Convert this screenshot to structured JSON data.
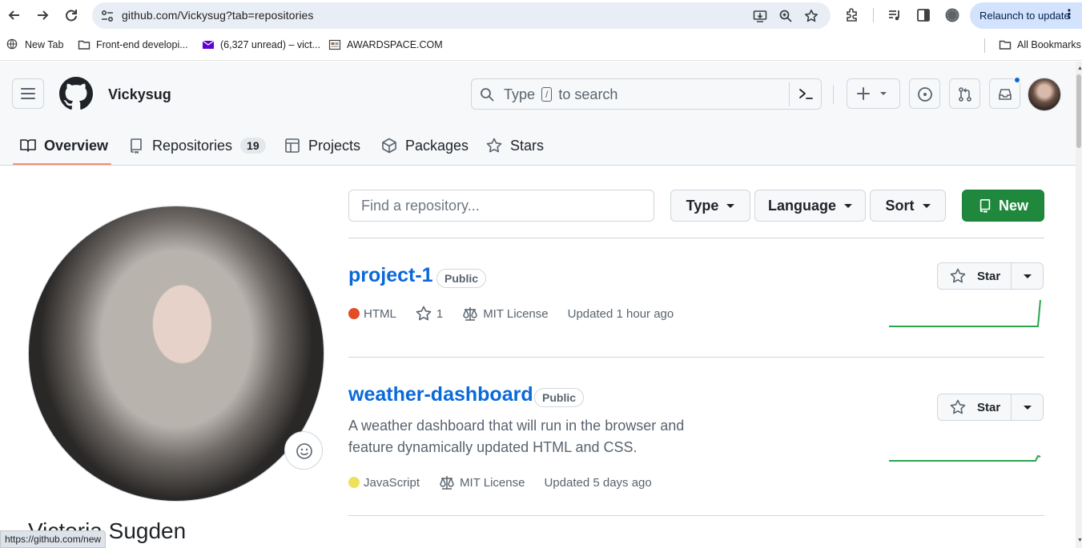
{
  "browser": {
    "url": "github.com/Vickysug?tab=repositories",
    "relaunch_label": "Relaunch to update",
    "bookmarks": [
      {
        "label": "New Tab"
      },
      {
        "label": "Front-end developi..."
      },
      {
        "label": "(6,327 unread) – vict..."
      },
      {
        "label": "AWARDSPACE.COM"
      }
    ],
    "all_bookmarks_label": "All Bookmarks",
    "status_url": "https://github.com/new"
  },
  "header": {
    "username": "Vickysug",
    "search_prefix": "Type",
    "search_key": "/",
    "search_suffix": "to search",
    "plus_label": "+"
  },
  "tabs": [
    {
      "label": "Overview",
      "active": true
    },
    {
      "label": "Repositories",
      "count": "19"
    },
    {
      "label": "Projects"
    },
    {
      "label": "Packages"
    },
    {
      "label": "Stars"
    }
  ],
  "profile": {
    "full_name": "Victoria Sugden"
  },
  "filters": {
    "search_placeholder": "Find a repository...",
    "type_label": "Type",
    "language_label": "Language",
    "sort_label": "Sort",
    "new_label": "New"
  },
  "repos": [
    {
      "name": "project-1",
      "visibility": "Public",
      "language": "HTML",
      "language_color": "#e34c26",
      "stars": "1",
      "license": "MIT License",
      "updated": "Updated 1 hour ago",
      "star_label": "Star"
    },
    {
      "name": "weather-dashboard",
      "visibility": "Public",
      "description_line1": "A weather dashboard that will run in the browser and",
      "description_line2": "feature dynamically updated HTML and CSS.",
      "language": "JavaScript",
      "language_color": "#f1e05a",
      "license": "MIT License",
      "updated": "Updated 5 days ago",
      "star_label": "Star"
    }
  ],
  "colors": {
    "accent_link": "#0969da",
    "new_button": "#1f883d",
    "tab_underline": "#fd8c73",
    "sparkline": "#2da44e"
  }
}
